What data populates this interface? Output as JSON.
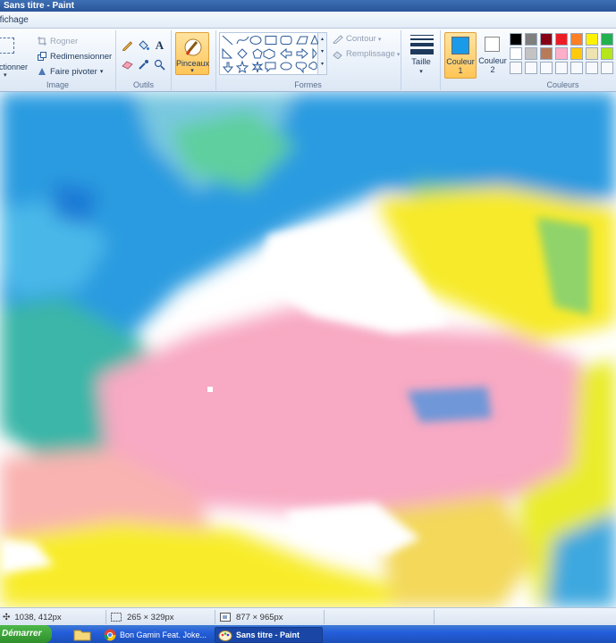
{
  "window": {
    "title": "Sans titre - Paint"
  },
  "menu": {
    "tab": "ffichage"
  },
  "ribbon": {
    "image_group": {
      "label": "Image",
      "select_label": "ectionner",
      "crop": "Rogner",
      "resize": "Redimensionner",
      "rotate": "Faire pivoter"
    },
    "tools_group": {
      "label": "Outils",
      "text_tool": "A"
    },
    "brushes_label": "Pinceaux",
    "shapes_group": {
      "label": "Formes",
      "outline": "Contour",
      "fill": "Remplissage"
    },
    "size_label": "Taille",
    "color1": {
      "label_line1": "Couleur",
      "label_line2": "1",
      "color": "#1a9bea"
    },
    "color2": {
      "label_line1": "Couleur",
      "label_line2": "2",
      "color": "#ffffff"
    },
    "colors_group": {
      "label": "Couleurs",
      "palette_row1": [
        "#000000",
        "#7f7f7f",
        "#880015",
        "#ed1c24",
        "#ff7f27",
        "#fff200",
        "#22b14c"
      ],
      "palette_row2": [
        "#ffffff",
        "#c3c3c3",
        "#b97a57",
        "#ffaec9",
        "#ffc90e",
        "#efe4b0",
        "#b5e61d"
      ],
      "palette_row3": [
        "",
        "",
        "",
        "",
        "",
        "",
        ""
      ]
    }
  },
  "status": {
    "cursor_pos": "1038, 412px",
    "selection_size": "265 × 329px",
    "image_size": "877 × 965px"
  },
  "taskbar": {
    "start": "Démarrer",
    "items": [
      "Bon Gamin Feat. Joke...",
      "Sans titre - Paint"
    ]
  }
}
